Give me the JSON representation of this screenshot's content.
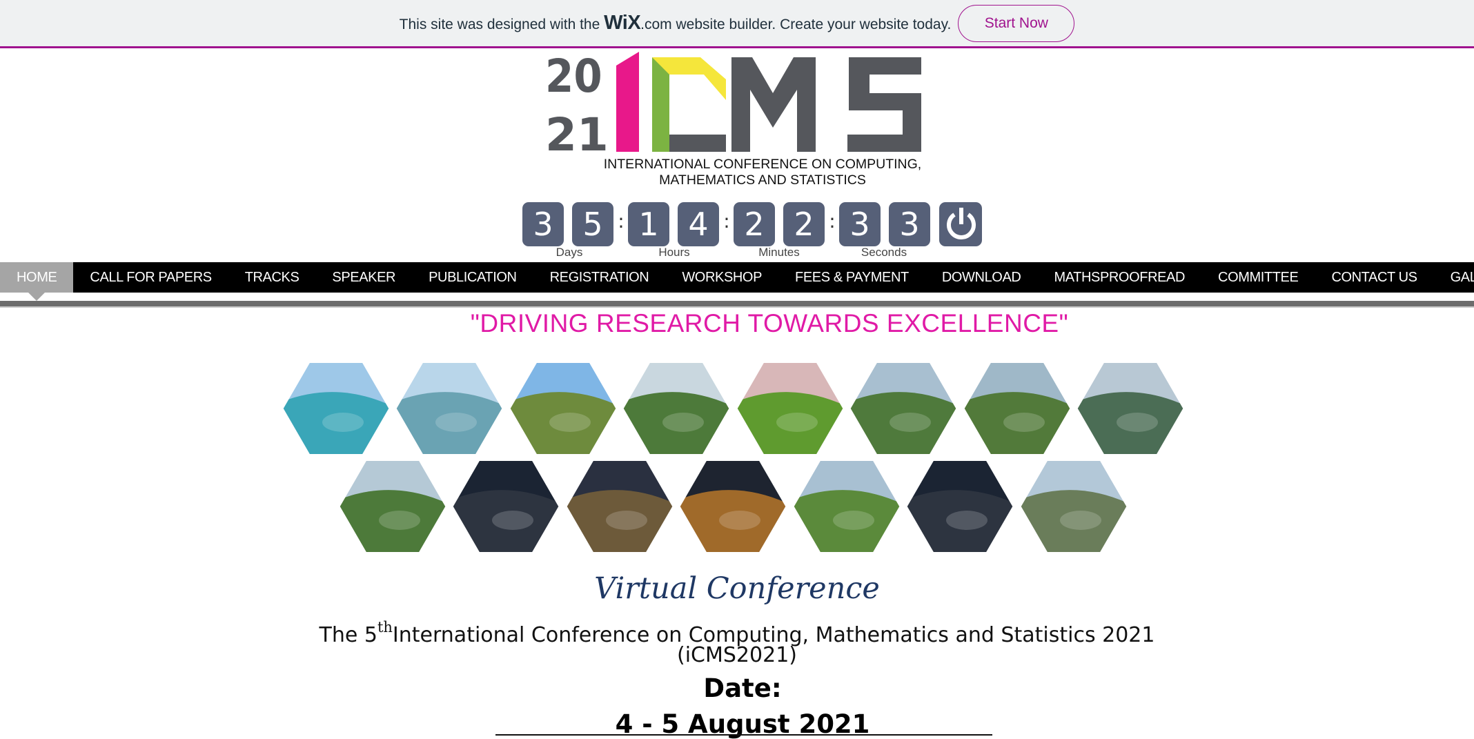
{
  "wix_banner": {
    "text_before": "This site was designed with the",
    "brand": "WiX",
    "text_after": ".com website builder. Create your website today.",
    "button_label": "Start Now"
  },
  "logo": {
    "year_top": "20",
    "year_bottom": "21",
    "letters": "iCMS",
    "caption_line1": "INTERNATIONAL CONFERENCE ON COMPUTING,",
    "caption_line2": "MATHEMATICS AND STATISTICS",
    "colors": {
      "i": "#e8188a",
      "c_green": "#7cb342",
      "c_yellow": "#f5e63b",
      "grey": "#55575c"
    }
  },
  "countdown": {
    "digits": [
      "3",
      "5",
      "1",
      "4",
      "2",
      "2",
      "3",
      "3"
    ],
    "units": [
      "Days",
      "Hours",
      "Minutes",
      "Seconds"
    ],
    "tile_color": "#566078",
    "icon": "power-icon"
  },
  "nav": {
    "items": [
      {
        "label": "HOME",
        "active": true
      },
      {
        "label": "CALL FOR PAPERS"
      },
      {
        "label": "TRACKS"
      },
      {
        "label": "SPEAKER"
      },
      {
        "label": "PUBLICATION"
      },
      {
        "label": "REGISTRATION"
      },
      {
        "label": "WORKSHOP"
      },
      {
        "label": "FEES & PAYMENT"
      },
      {
        "label": "DOWNLOAD"
      },
      {
        "label": "MATHSPROOFREAD"
      },
      {
        "label": "COMMITTEE"
      },
      {
        "label": "CONTACT US"
      },
      {
        "label": "GALLERY"
      }
    ]
  },
  "tagline": "\"DRIVING RESEARCH TOWARDS EXCELLENCE\"",
  "gallery": {
    "photos": [
      {
        "name": "beach-photo",
        "sky": "#9ec8e8",
        "ground": "#3aa6b8"
      },
      {
        "name": "coast-photo",
        "sky": "#b9d6ea",
        "ground": "#6aa3b3"
      },
      {
        "name": "garden-photo",
        "sky": "#7fb6e6",
        "ground": "#6e8b3d"
      },
      {
        "name": "campus-road-photo",
        "sky": "#c9d7df",
        "ground": "#4d7a3a"
      },
      {
        "name": "paddy-field-photo",
        "sky": "#d8b7b8",
        "ground": "#5f9b2f"
      },
      {
        "name": "mountain-campus-photo",
        "sky": "#a8bfd0",
        "ground": "#4f7a3c"
      },
      {
        "name": "campus-aerial-photo",
        "sky": "#9fb8c8",
        "ground": "#527a3a"
      },
      {
        "name": "harbour-photo",
        "sky": "#b8c8d4",
        "ground": "#4b6d55"
      },
      {
        "name": "river-photo",
        "sky": "#b5c9d6",
        "ground": "#4d7a3a"
      },
      {
        "name": "night-campus-photo",
        "sky": "#1b2433",
        "ground": "#2d3440"
      },
      {
        "name": "night-plaza-photo",
        "sky": "#2a3040",
        "ground": "#6d5a3a"
      },
      {
        "name": "night-highway-photo",
        "sky": "#1e2430",
        "ground": "#a06a2a"
      },
      {
        "name": "courts-photo",
        "sky": "#a8c0d2",
        "ground": "#5b8a3b"
      },
      {
        "name": "night-campus-2-photo",
        "sky": "#1b2433",
        "ground": "#2d3440"
      },
      {
        "name": "main-building-photo",
        "sky": "#b3c8d8",
        "ground": "#6a7d5a"
      }
    ]
  },
  "conference": {
    "mode": "Virtual Conference",
    "title_prefix": "The 5",
    "title_sup": "th",
    "title_rest": "International Conference on Computing, Mathematics and Statistics 2021",
    "abbr": "(iCMS2021)",
    "date_label": "Date:",
    "date_value": "4 - 5 August 2021"
  }
}
